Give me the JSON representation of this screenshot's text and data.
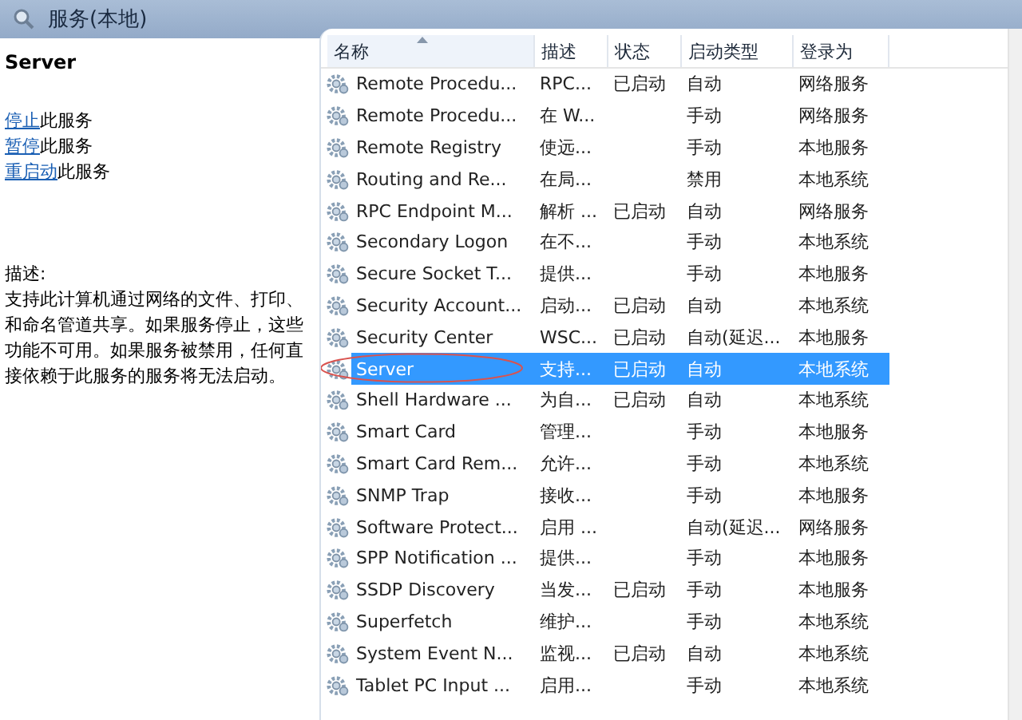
{
  "window": {
    "title": "服务(本地)"
  },
  "details": {
    "service_name": "Server",
    "actions": [
      {
        "link": "停止",
        "rest": "此服务"
      },
      {
        "link": "暂停",
        "rest": "此服务"
      },
      {
        "link": "重启动",
        "rest": "此服务"
      }
    ],
    "description_label": "描述:",
    "description": "支持此计算机通过网络的文件、打印、和命名管道共享。如果服务停止，这些功能不可用。如果服务被禁用，任何直接依赖于此服务的服务将无法启动。"
  },
  "table": {
    "columns": [
      {
        "label": "名称",
        "sorted": true
      },
      {
        "label": "描述",
        "sorted": false
      },
      {
        "label": "状态",
        "sorted": false
      },
      {
        "label": "启动类型",
        "sorted": false
      },
      {
        "label": "登录为",
        "sorted": false
      }
    ],
    "rows": [
      {
        "name": "Remote Procedu...",
        "description": "RPC...",
        "status": "已启动",
        "startup": "自动",
        "logon": "网络服务",
        "selected": false,
        "circled": false
      },
      {
        "name": "Remote Procedu...",
        "description": "在 W...",
        "status": "",
        "startup": "手动",
        "logon": "网络服务",
        "selected": false,
        "circled": false
      },
      {
        "name": "Remote Registry",
        "description": "使远...",
        "status": "",
        "startup": "手动",
        "logon": "本地服务",
        "selected": false,
        "circled": false
      },
      {
        "name": "Routing and Re...",
        "description": "在局...",
        "status": "",
        "startup": "禁用",
        "logon": "本地系统",
        "selected": false,
        "circled": false
      },
      {
        "name": "RPC Endpoint M...",
        "description": "解析 ...",
        "status": "已启动",
        "startup": "自动",
        "logon": "网络服务",
        "selected": false,
        "circled": false
      },
      {
        "name": "Secondary Logon",
        "description": "在不...",
        "status": "",
        "startup": "手动",
        "logon": "本地系统",
        "selected": false,
        "circled": false
      },
      {
        "name": "Secure Socket T...",
        "description": "提供...",
        "status": "",
        "startup": "手动",
        "logon": "本地服务",
        "selected": false,
        "circled": false
      },
      {
        "name": "Security Account...",
        "description": "启动...",
        "status": "已启动",
        "startup": "自动",
        "logon": "本地系统",
        "selected": false,
        "circled": false
      },
      {
        "name": "Security Center",
        "description": "WSC...",
        "status": "已启动",
        "startup": "自动(延迟...",
        "logon": "本地服务",
        "selected": false,
        "circled": false
      },
      {
        "name": "Server",
        "description": "支持...",
        "status": "已启动",
        "startup": "自动",
        "logon": "本地系统",
        "selected": true,
        "circled": true
      },
      {
        "name": "Shell Hardware ...",
        "description": "为自...",
        "status": "已启动",
        "startup": "自动",
        "logon": "本地系统",
        "selected": false,
        "circled": false
      },
      {
        "name": "Smart Card",
        "description": "管理...",
        "status": "",
        "startup": "手动",
        "logon": "本地服务",
        "selected": false,
        "circled": false
      },
      {
        "name": "Smart Card Rem...",
        "description": "允许...",
        "status": "",
        "startup": "手动",
        "logon": "本地系统",
        "selected": false,
        "circled": false
      },
      {
        "name": "SNMP Trap",
        "description": "接收...",
        "status": "",
        "startup": "手动",
        "logon": "本地服务",
        "selected": false,
        "circled": false
      },
      {
        "name": "Software Protect...",
        "description": "启用 ...",
        "status": "",
        "startup": "自动(延迟...",
        "logon": "网络服务",
        "selected": false,
        "circled": false
      },
      {
        "name": "SPP Notification ...",
        "description": "提供...",
        "status": "",
        "startup": "手动",
        "logon": "本地服务",
        "selected": false,
        "circled": false
      },
      {
        "name": "SSDP Discovery",
        "description": "当发...",
        "status": "已启动",
        "startup": "手动",
        "logon": "本地服务",
        "selected": false,
        "circled": false
      },
      {
        "name": "Superfetch",
        "description": "维护...",
        "status": "",
        "startup": "手动",
        "logon": "本地系统",
        "selected": false,
        "circled": false
      },
      {
        "name": "System Event N...",
        "description": "监视...",
        "status": "已启动",
        "startup": "自动",
        "logon": "本地系统",
        "selected": false,
        "circled": false
      },
      {
        "name": "Tablet PC Input ...",
        "description": "启用...",
        "status": "",
        "startup": "手动",
        "logon": "本地系统",
        "selected": false,
        "circled": false
      }
    ]
  }
}
